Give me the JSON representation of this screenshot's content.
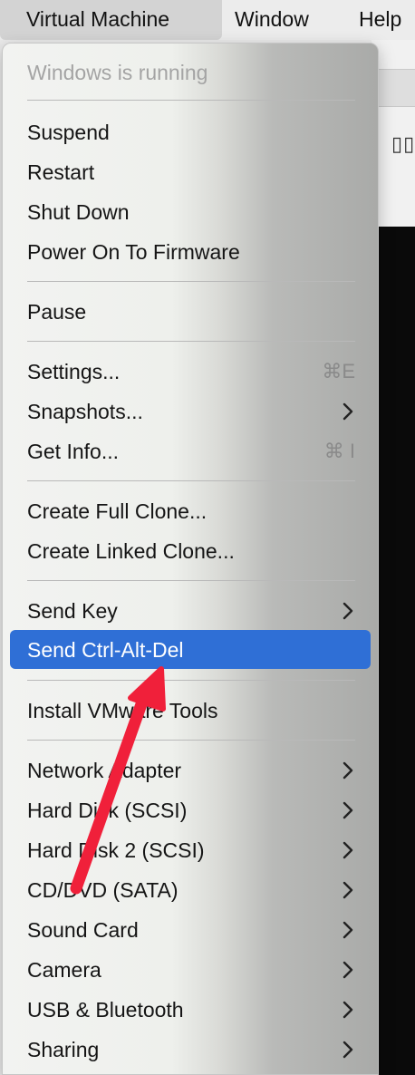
{
  "menubar": {
    "vm": "Virtual Machine",
    "window": "Window",
    "help": "Help"
  },
  "background": {
    "pause_glyph": "▯▯"
  },
  "menu": {
    "status": "Windows is running",
    "suspend": "Suspend",
    "restart": "Restart",
    "shutdown": "Shut Down",
    "power_firmware": "Power On To Firmware",
    "pause": "Pause",
    "settings": "Settings...",
    "settings_shortcut": "⌘E",
    "snapshots": "Snapshots...",
    "get_info": "Get Info...",
    "get_info_shortcut": "⌘ I",
    "full_clone": "Create Full Clone...",
    "linked_clone": "Create Linked Clone...",
    "send_key": "Send Key",
    "send_cad": "Send Ctrl-Alt-Del",
    "install_tools": "Install VMware Tools",
    "network": "Network Adapter",
    "hard_disk": "Hard Disk (SCSI)",
    "hard_disk2": "Hard Disk 2 (SCSI)",
    "cd_dvd": "CD/DVD (SATA)",
    "sound": "Sound Card",
    "camera": "Camera",
    "usb": "USB & Bluetooth",
    "sharing": "Sharing"
  },
  "colors": {
    "highlight": "#2f6fd6",
    "arrow": "#f0203a"
  }
}
